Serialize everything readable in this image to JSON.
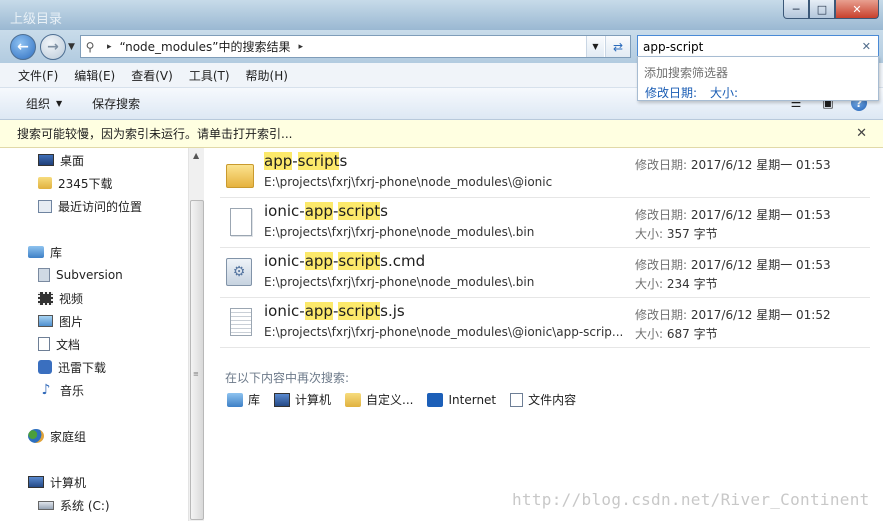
{
  "window": {
    "title_blur": "上级目录",
    "btn_min": "─",
    "btn_max": "□",
    "btn_close": "✕"
  },
  "address": {
    "icon_name": "search-location-icon",
    "crumb": "“node_modules”中的搜索结果",
    "sep": "▸"
  },
  "search": {
    "value": "app-script",
    "clear": "✕"
  },
  "filter": {
    "title": "添加搜索筛选器",
    "date_link": "修改日期:",
    "size_link": "大小:"
  },
  "menu": [
    "文件(F)",
    "编辑(E)",
    "查看(V)",
    "工具(T)",
    "帮助(H)"
  ],
  "toolbar": {
    "organize": "组织",
    "save_search": "保存搜索",
    "help": "?"
  },
  "infobar": {
    "message": "搜索可能较慢，因为索引未运行。请单击打开索引...",
    "close": "✕"
  },
  "sidebar": {
    "favorites": [
      "桌面",
      "2345下载",
      "最近访问的位置"
    ],
    "library_header": "库",
    "libraries": [
      "Subversion",
      "视频",
      "图片",
      "文档",
      "迅雷下载",
      "音乐"
    ],
    "homegroup": "家庭组",
    "computer": "计算机",
    "drive": "系统 (C:)"
  },
  "results": [
    {
      "icon": "folder-icon",
      "name_pre": "",
      "name_hl1": "app",
      "name_mid": "-",
      "name_hl2": "script",
      "name_post": "s",
      "path": "E:\\projects\\fxrj\\fxrj-phone\\node_modules\\@ionic",
      "date_label": "修改日期:",
      "date": "2017/6/12 星期一 01:53",
      "size_label": "",
      "size": ""
    },
    {
      "icon": "file-icon",
      "name_pre": "ionic-",
      "name_hl1": "app",
      "name_mid": "-",
      "name_hl2": "script",
      "name_post": "s",
      "path": "E:\\projects\\fxrj\\fxrj-phone\\node_modules\\.bin",
      "date_label": "修改日期:",
      "date": "2017/6/12 星期一 01:53",
      "size_label": "大小:",
      "size": "357 字节"
    },
    {
      "icon": "cmd-file-icon",
      "name_pre": "ionic-",
      "name_hl1": "app",
      "name_mid": "-",
      "name_hl2": "script",
      "name_post": "s.cmd",
      "path": "E:\\projects\\fxrj\\fxrj-phone\\node_modules\\.bin",
      "date_label": "修改日期:",
      "date": "2017/6/12 星期一 01:53",
      "size_label": "大小:",
      "size": "234 字节"
    },
    {
      "icon": "js-file-icon",
      "name_pre": "ionic-",
      "name_hl1": "app",
      "name_mid": "-",
      "name_hl2": "script",
      "name_post": "s.js",
      "path": "E:\\projects\\fxrj\\fxrj-phone\\node_modules\\@ionic\\app-scrip...",
      "date_label": "修改日期:",
      "date": "2017/6/12 星期一 01:52",
      "size_label": "大小:",
      "size": "687 字节"
    }
  ],
  "search_again": {
    "title": "在以下内容中再次搜索:",
    "items": [
      "库",
      "计算机",
      "自定义...",
      "Internet",
      "文件内容"
    ]
  },
  "watermark": "http://blog.csdn.net/River_Continent",
  "colors": {
    "highlight": "#fce96b",
    "link": "#1a5db4",
    "infobar": "#ffffe1"
  }
}
